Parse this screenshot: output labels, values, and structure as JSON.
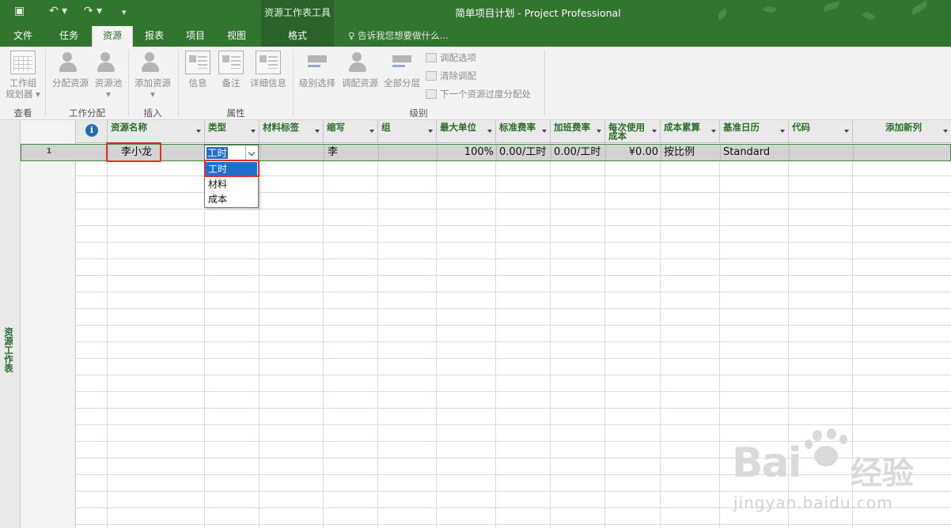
{
  "app": {
    "window_title": "简单项目计划 - Project Professional",
    "context_tool_label": "资源工作表工具",
    "colors": {
      "brand": "#31752f",
      "ribbon_bg": "#f3f3f3",
      "selection": "#1e6fd1",
      "annotation": "#e0302a",
      "header_text": "#2d6b2c"
    }
  },
  "quick_access": {
    "save_icon": "save-icon",
    "undo_icon": "undo-icon",
    "redo_icon": "redo-icon",
    "customize_icon": "customize-qat-icon"
  },
  "tabs": [
    {
      "label": "文件"
    },
    {
      "label": "任务"
    },
    {
      "label": "资源"
    },
    {
      "label": "报表"
    },
    {
      "label": "项目"
    },
    {
      "label": "视图"
    },
    {
      "label": "格式"
    }
  ],
  "tell_me": "告诉我您想要做什么...",
  "ribbon": {
    "groups": {
      "view": "查看",
      "assignments": "工作分配",
      "insert": "插入",
      "properties": "属性",
      "level": "级别"
    },
    "buttons": {
      "team_planner_1": "工作组",
      "team_planner_2": "规划器",
      "assign_resources": "分配资源",
      "resource_pool": "资源池",
      "add_resources": "添加资源",
      "information": "信息",
      "notes": "备注",
      "details": "详细信息",
      "level_selection": "级别选择",
      "level_resource": "调配资源",
      "level_all": "全部分层",
      "leveling_options": "调配选项",
      "clear_leveling": "清除调配",
      "next_overallocation": "下一个资源过度分配处"
    }
  },
  "sheet": {
    "view_label": "资源工作表",
    "columns": [
      {
        "key": "info",
        "label": ""
      },
      {
        "key": "name",
        "label": "资源名称"
      },
      {
        "key": "type",
        "label": "类型"
      },
      {
        "key": "material_label",
        "label": "材料标签"
      },
      {
        "key": "initials",
        "label": "缩写"
      },
      {
        "key": "group",
        "label": "组"
      },
      {
        "key": "max_units",
        "label": "最大单位"
      },
      {
        "key": "std_rate",
        "label": "标准费率"
      },
      {
        "key": "ovt_rate",
        "label": "加班费率"
      },
      {
        "key": "cost_use",
        "label": "每次使用成本"
      },
      {
        "key": "accrue",
        "label": "成本累算"
      },
      {
        "key": "base_cal",
        "label": "基准日历"
      },
      {
        "key": "code",
        "label": "代码"
      },
      {
        "key": "add_col",
        "label": "添加新列"
      }
    ],
    "rows": [
      {
        "id": "1",
        "name": "李小龙",
        "type": "工时",
        "material_label": "",
        "initials": "李",
        "group": "",
        "max_units": "100%",
        "std_rate": "0.00/工时",
        "ovt_rate": "0.00/工时",
        "cost_use": "¥0.00",
        "accrue": "按比例",
        "base_cal": "Standard",
        "code": ""
      }
    ],
    "type_dropdown": {
      "selected": "工时",
      "options": [
        "工时",
        "材料",
        "成本"
      ]
    }
  },
  "watermark": {
    "logo_text": "Bai",
    "logo_suffix": "经验",
    "url": "jingyan.baidu.com"
  }
}
